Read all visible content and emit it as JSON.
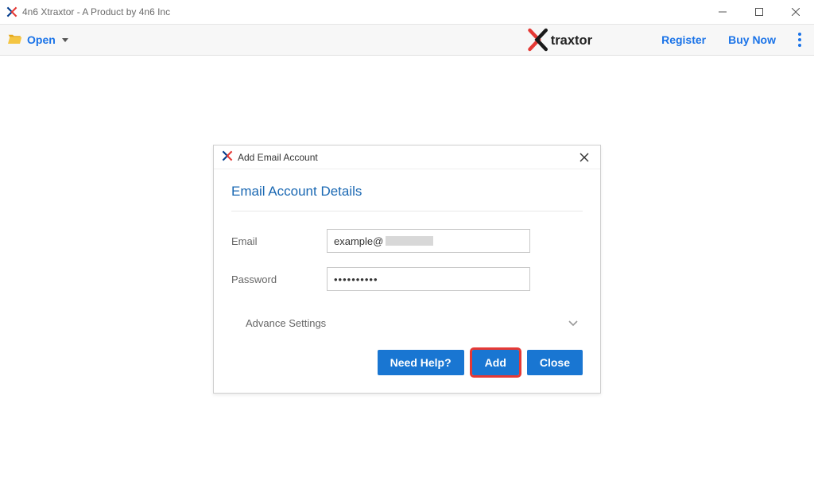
{
  "window": {
    "title": "4n6 Xtraxtor - A Product by 4n6 Inc"
  },
  "toolbar": {
    "open_label": "Open",
    "register_label": "Register",
    "buy_label": "Buy Now"
  },
  "dialog": {
    "title": "Add Email Account",
    "section_title": "Email Account Details",
    "email_label": "Email",
    "email_value": "example@",
    "password_label": "Password",
    "password_value": "••••••••••",
    "advance_label": "Advance Settings",
    "buttons": {
      "need_help": "Need Help?",
      "add": "Add",
      "close": "Close"
    }
  }
}
